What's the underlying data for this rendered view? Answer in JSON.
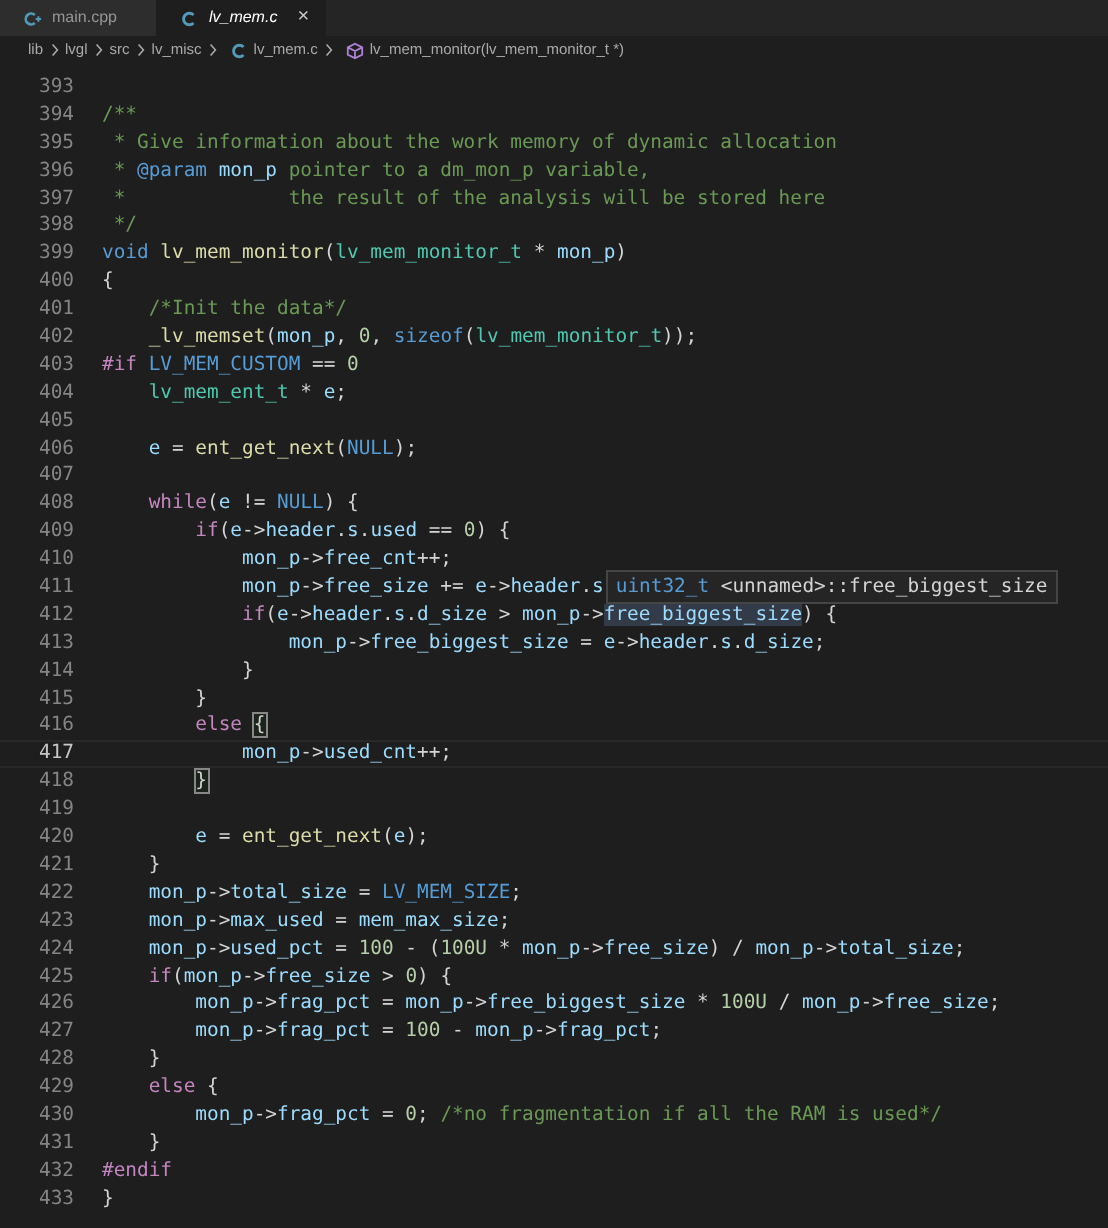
{
  "tabs": [
    {
      "label": "main.cpp",
      "kind": "cpp",
      "selected": false
    },
    {
      "label": "lv_mem.c",
      "kind": "c",
      "selected": true,
      "close": "×"
    }
  ],
  "breadcrumb": [
    {
      "label": "lib",
      "kind": "folder"
    },
    {
      "label": "lvgl",
      "kind": "folder"
    },
    {
      "label": "src",
      "kind": "folder"
    },
    {
      "label": "lv_misc",
      "kind": "folder"
    },
    {
      "label": "lv_mem.c",
      "kind": "c"
    },
    {
      "label": "lv_mem_monitor(lv_mem_monitor_t *)",
      "kind": "function"
    }
  ],
  "lines": [
    {
      "number": "393",
      "current": false
    },
    {
      "number": "394",
      "current": false,
      "tokens": [
        {
          "kind": "cm",
          "text": "/**"
        }
      ]
    },
    {
      "number": "395",
      "current": false,
      "tokens": [
        {
          "kind": "cm",
          "text": " * Give information about the work memory of dynamic allocation"
        }
      ]
    },
    {
      "number": "396",
      "current": false,
      "tokens": [
        {
          "kind": "cm",
          "text": " * "
        },
        {
          "kind": "tag",
          "text": "@param "
        },
        {
          "kind": "va",
          "text": "mon_p"
        },
        {
          "kind": "cm",
          "text": " pointer to a dm_mon_p variable,"
        }
      ]
    },
    {
      "number": "397",
      "current": false,
      "tokens": [
        {
          "kind": "cm",
          "text": " *              the result of the analysis will be stored here"
        }
      ]
    },
    {
      "number": "398",
      "current": false,
      "tokens": [
        {
          "kind": "cm",
          "text": " */"
        }
      ]
    },
    {
      "number": "399",
      "current": false,
      "tokens": [
        {
          "kind": "kw",
          "text": "void "
        },
        {
          "kind": "fn",
          "text": "lv_mem_monitor"
        },
        {
          "kind": "pl",
          "text": "("
        },
        {
          "kind": "ty",
          "text": "lv_mem_monitor_t"
        },
        {
          "kind": "pl",
          "text": " * "
        },
        {
          "kind": "va",
          "text": "mon_p"
        },
        {
          "kind": "pl",
          "text": ")"
        }
      ]
    },
    {
      "number": "400",
      "current": false,
      "tokens": [
        {
          "kind": "pl",
          "text": "{"
        }
      ]
    },
    {
      "number": "401",
      "current": false,
      "tokens": [
        {
          "kind": "cm",
          "text": "    /*Init the data*/"
        }
      ]
    },
    {
      "number": "402",
      "current": false,
      "tokens": [
        {
          "kind": "fn",
          "text": "    _lv_memset"
        },
        {
          "kind": "pl",
          "text": "("
        },
        {
          "kind": "va",
          "text": "mon_p"
        },
        {
          "kind": "pl",
          "text": ", "
        },
        {
          "kind": "nu",
          "text": "0"
        },
        {
          "kind": "pl",
          "text": ", "
        },
        {
          "kind": "kw",
          "text": "sizeof"
        },
        {
          "kind": "pl",
          "text": "("
        },
        {
          "kind": "ty",
          "text": "lv_mem_monitor_t"
        },
        {
          "kind": "pl",
          "text": "));"
        }
      ]
    },
    {
      "number": "403",
      "current": false,
      "tokens": [
        {
          "kind": "pp",
          "text": "#if "
        },
        {
          "kind": "mac",
          "text": "LV_MEM_CUSTOM"
        },
        {
          "kind": "pl",
          "text": " == "
        },
        {
          "kind": "nu",
          "text": "0"
        }
      ]
    },
    {
      "number": "404",
      "current": false,
      "tokens": [
        {
          "kind": "ty",
          "text": "    lv_mem_ent_t"
        },
        {
          "kind": "pl",
          "text": " * "
        },
        {
          "kind": "va",
          "text": "e"
        },
        {
          "kind": "pl",
          "text": ";"
        }
      ]
    },
    {
      "number": "405",
      "current": false
    },
    {
      "number": "406",
      "current": false,
      "tokens": [
        {
          "kind": "va",
          "text": "    e"
        },
        {
          "kind": "pl",
          "text": " = "
        },
        {
          "kind": "fn",
          "text": "ent_get_next"
        },
        {
          "kind": "pl",
          "text": "("
        },
        {
          "kind": "kw",
          "text": "NULL"
        },
        {
          "kind": "pl",
          "text": ");"
        }
      ]
    },
    {
      "number": "407",
      "current": false
    },
    {
      "number": "408",
      "current": false,
      "tokens": [
        {
          "kind": "ctl",
          "text": "    while"
        },
        {
          "kind": "pl",
          "text": "("
        },
        {
          "kind": "va",
          "text": "e"
        },
        {
          "kind": "pl",
          "text": " != "
        },
        {
          "kind": "kw",
          "text": "NULL"
        },
        {
          "kind": "pl",
          "text": ") {"
        }
      ]
    },
    {
      "number": "409",
      "current": false,
      "tokens": [
        {
          "kind": "ctl",
          "text": "        if"
        },
        {
          "kind": "pl",
          "text": "("
        },
        {
          "kind": "va",
          "text": "e"
        },
        {
          "kind": "pl",
          "text": "->"
        },
        {
          "kind": "va",
          "text": "header"
        },
        {
          "kind": "pl",
          "text": "."
        },
        {
          "kind": "va",
          "text": "s"
        },
        {
          "kind": "pl",
          "text": "."
        },
        {
          "kind": "va",
          "text": "used"
        },
        {
          "kind": "pl",
          "text": " == "
        },
        {
          "kind": "nu",
          "text": "0"
        },
        {
          "kind": "pl",
          "text": ") {"
        }
      ]
    },
    {
      "number": "410",
      "current": false,
      "tokens": [
        {
          "kind": "va",
          "text": "            mon_p"
        },
        {
          "kind": "pl",
          "text": "->"
        },
        {
          "kind": "va",
          "text": "free_cnt"
        },
        {
          "kind": "pl",
          "text": "++;"
        }
      ]
    },
    {
      "number": "411",
      "current": false,
      "tokens": [
        {
          "kind": "va",
          "text": "            mon_p"
        },
        {
          "kind": "pl",
          "text": "->"
        },
        {
          "kind": "va",
          "text": "free_size"
        },
        {
          "kind": "pl",
          "text": " += "
        },
        {
          "kind": "va",
          "text": "e"
        },
        {
          "kind": "pl",
          "text": "->"
        },
        {
          "kind": "va",
          "text": "header"
        },
        {
          "kind": "pl",
          "text": "."
        },
        {
          "kind": "va",
          "text": "s"
        }
      ],
      "hover": [
        {
          "kind": "ty-kw",
          "text": "uint32_t"
        },
        {
          "kind": "pl",
          "text": " <unnamed>::free_biggest_size"
        }
      ]
    },
    {
      "number": "412",
      "current": false,
      "tokens": [
        {
          "kind": "ctl",
          "text": "            if"
        },
        {
          "kind": "pl",
          "text": "("
        },
        {
          "kind": "va",
          "text": "e"
        },
        {
          "kind": "pl",
          "text": "->"
        },
        {
          "kind": "va",
          "text": "header"
        },
        {
          "kind": "pl",
          "text": "."
        },
        {
          "kind": "va",
          "text": "s"
        },
        {
          "kind": "pl",
          "text": "."
        },
        {
          "kind": "va",
          "text": "d_size"
        },
        {
          "kind": "pl",
          "text": " > "
        },
        {
          "kind": "va",
          "text": "mon_p"
        },
        {
          "kind": "pl",
          "text": "->"
        },
        {
          "kind": "va-hover",
          "text": "free_biggest_size"
        },
        {
          "kind": "pl",
          "text": ") {"
        }
      ]
    },
    {
      "number": "413",
      "current": false,
      "tokens": [
        {
          "kind": "va",
          "text": "                mon_p"
        },
        {
          "kind": "pl",
          "text": "->"
        },
        {
          "kind": "va",
          "text": "free_biggest_size"
        },
        {
          "kind": "pl",
          "text": " = "
        },
        {
          "kind": "va",
          "text": "e"
        },
        {
          "kind": "pl",
          "text": "->"
        },
        {
          "kind": "va",
          "text": "header"
        },
        {
          "kind": "pl",
          "text": "."
        },
        {
          "kind": "va",
          "text": "s"
        },
        {
          "kind": "pl",
          "text": "."
        },
        {
          "kind": "va",
          "text": "d_size"
        },
        {
          "kind": "pl",
          "text": ";"
        }
      ]
    },
    {
      "number": "414",
      "current": false,
      "tokens": [
        {
          "kind": "pl",
          "text": "            }"
        }
      ]
    },
    {
      "number": "415",
      "current": false,
      "tokens": [
        {
          "kind": "pl",
          "text": "        }"
        }
      ]
    },
    {
      "number": "416",
      "current": false,
      "tokens": [
        {
          "kind": "ctl",
          "text": "        else "
        },
        {
          "kind": "brace-match",
          "text": "{"
        }
      ]
    },
    {
      "number": "417",
      "current": true,
      "tokens": [
        {
          "kind": "va",
          "text": "            mon_p"
        },
        {
          "kind": "pl",
          "text": "->"
        },
        {
          "kind": "va",
          "text": "used_cnt"
        },
        {
          "kind": "pl",
          "text": "++;"
        }
      ]
    },
    {
      "number": "418",
      "current": false,
      "tokens": [
        {
          "kind": "brace-match",
          "text": "        }"
        }
      ]
    },
    {
      "number": "419",
      "current": false
    },
    {
      "number": "420",
      "current": false,
      "tokens": [
        {
          "kind": "va",
          "text": "        e"
        },
        {
          "kind": "pl",
          "text": " = "
        },
        {
          "kind": "fn",
          "text": "ent_get_next"
        },
        {
          "kind": "pl",
          "text": "("
        },
        {
          "kind": "va",
          "text": "e"
        },
        {
          "kind": "pl",
          "text": ");"
        }
      ]
    },
    {
      "number": "421",
      "current": false,
      "tokens": [
        {
          "kind": "pl",
          "text": "    }"
        }
      ]
    },
    {
      "number": "422",
      "current": false,
      "tokens": [
        {
          "kind": "va",
          "text": "    mon_p"
        },
        {
          "kind": "pl",
          "text": "->"
        },
        {
          "kind": "va",
          "text": "total_size"
        },
        {
          "kind": "pl",
          "text": " = "
        },
        {
          "kind": "mac",
          "text": "LV_MEM_SIZE"
        },
        {
          "kind": "pl",
          "text": ";"
        }
      ]
    },
    {
      "number": "423",
      "current": false,
      "tokens": [
        {
          "kind": "va",
          "text": "    mon_p"
        },
        {
          "kind": "pl",
          "text": "->"
        },
        {
          "kind": "va",
          "text": "max_used"
        },
        {
          "kind": "pl",
          "text": " = "
        },
        {
          "kind": "va",
          "text": "mem_max_size"
        },
        {
          "kind": "pl",
          "text": ";"
        }
      ]
    },
    {
      "number": "424",
      "current": false,
      "tokens": [
        {
          "kind": "va",
          "text": "    mon_p"
        },
        {
          "kind": "pl",
          "text": "->"
        },
        {
          "kind": "va",
          "text": "used_pct"
        },
        {
          "kind": "pl",
          "text": " = "
        },
        {
          "kind": "nu",
          "text": "100"
        },
        {
          "kind": "pl",
          "text": " - ("
        },
        {
          "kind": "nu",
          "text": "100U"
        },
        {
          "kind": "pl",
          "text": " * "
        },
        {
          "kind": "va",
          "text": "mon_p"
        },
        {
          "kind": "pl",
          "text": "->"
        },
        {
          "kind": "va",
          "text": "free_size"
        },
        {
          "kind": "pl",
          "text": ") / "
        },
        {
          "kind": "va",
          "text": "mon_p"
        },
        {
          "kind": "pl",
          "text": "->"
        },
        {
          "kind": "va",
          "text": "total_size"
        },
        {
          "kind": "pl",
          "text": ";"
        }
      ]
    },
    {
      "number": "425",
      "current": false,
      "tokens": [
        {
          "kind": "ctl",
          "text": "    if"
        },
        {
          "kind": "pl",
          "text": "("
        },
        {
          "kind": "va",
          "text": "mon_p"
        },
        {
          "kind": "pl",
          "text": "->"
        },
        {
          "kind": "va",
          "text": "free_size"
        },
        {
          "kind": "pl",
          "text": " > "
        },
        {
          "kind": "nu",
          "text": "0"
        },
        {
          "kind": "pl",
          "text": ") {"
        }
      ]
    },
    {
      "number": "426",
      "current": false,
      "tokens": [
        {
          "kind": "va",
          "text": "        mon_p"
        },
        {
          "kind": "pl",
          "text": "->"
        },
        {
          "kind": "va",
          "text": "frag_pct"
        },
        {
          "kind": "pl",
          "text": " = "
        },
        {
          "kind": "va",
          "text": "mon_p"
        },
        {
          "kind": "pl",
          "text": "->"
        },
        {
          "kind": "va",
          "text": "free_biggest_size"
        },
        {
          "kind": "pl",
          "text": " * "
        },
        {
          "kind": "nu",
          "text": "100U"
        },
        {
          "kind": "pl",
          "text": " / "
        },
        {
          "kind": "va",
          "text": "mon_p"
        },
        {
          "kind": "pl",
          "text": "->"
        },
        {
          "kind": "va",
          "text": "free_size"
        },
        {
          "kind": "pl",
          "text": ";"
        }
      ]
    },
    {
      "number": "427",
      "current": false,
      "tokens": [
        {
          "kind": "va",
          "text": "        mon_p"
        },
        {
          "kind": "pl",
          "text": "->"
        },
        {
          "kind": "va",
          "text": "frag_pct"
        },
        {
          "kind": "pl",
          "text": " = "
        },
        {
          "kind": "nu",
          "text": "100"
        },
        {
          "kind": "pl",
          "text": " - "
        },
        {
          "kind": "va",
          "text": "mon_p"
        },
        {
          "kind": "pl",
          "text": "->"
        },
        {
          "kind": "va",
          "text": "frag_pct"
        },
        {
          "kind": "pl",
          "text": ";"
        }
      ]
    },
    {
      "number": "428",
      "current": false,
      "tokens": [
        {
          "kind": "pl",
          "text": "    }"
        }
      ]
    },
    {
      "number": "429",
      "current": false,
      "tokens": [
        {
          "kind": "ctl",
          "text": "    else"
        },
        {
          "kind": "pl",
          "text": " {"
        }
      ]
    },
    {
      "number": "430",
      "current": false,
      "tokens": [
        {
          "kind": "va",
          "text": "        mon_p"
        },
        {
          "kind": "pl",
          "text": "->"
        },
        {
          "kind": "va",
          "text": "frag_pct"
        },
        {
          "kind": "pl",
          "text": " = "
        },
        {
          "kind": "nu",
          "text": "0"
        },
        {
          "kind": "pl",
          "text": "; "
        },
        {
          "kind": "cm",
          "text": "/*no fragmentation if all the RAM is used*/"
        }
      ]
    },
    {
      "number": "431",
      "current": false,
      "tokens": [
        {
          "kind": "pl",
          "text": "    }"
        }
      ]
    },
    {
      "number": "432",
      "current": false,
      "tokens": [
        {
          "kind": "pp",
          "text": "#endif"
        }
      ]
    },
    {
      "number": "433",
      "current": false,
      "tokens": [
        {
          "kind": "pl",
          "text": "}"
        }
      ]
    }
  ]
}
